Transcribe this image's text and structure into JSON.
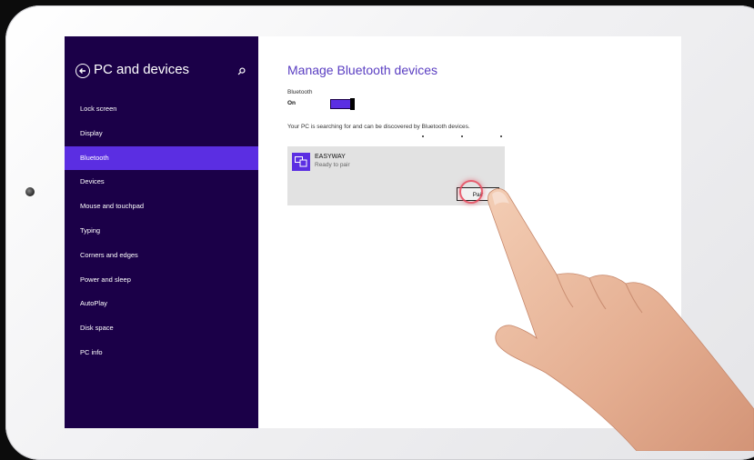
{
  "sidebar": {
    "title": "PC and devices",
    "items": [
      {
        "label": "Lock screen"
      },
      {
        "label": "Display"
      },
      {
        "label": "Bluetooth",
        "active": true
      },
      {
        "label": "Devices"
      },
      {
        "label": "Mouse and touchpad"
      },
      {
        "label": "Typing"
      },
      {
        "label": "Corners and edges"
      },
      {
        "label": "Power and sleep"
      },
      {
        "label": "AutoPlay"
      },
      {
        "label": "Disk space"
      },
      {
        "label": "PC info"
      }
    ]
  },
  "main": {
    "title": "Manage Bluetooth devices",
    "bluetooth_label": "Bluetooth",
    "bluetooth_state": "On",
    "status": "Your PC is searching for and can be discovered by Bluetooth devices.",
    "device": {
      "name": "EASYWAY",
      "status": "Ready to pair",
      "button_label": "Pair"
    }
  },
  "icons": {
    "back": "back-arrow-icon",
    "search": "search-icon",
    "device": "bluetooth-device-icon"
  },
  "colors": {
    "sidebar_bg": "#1b0048",
    "accent": "#5b2ee2",
    "title": "#5a3ec2"
  }
}
